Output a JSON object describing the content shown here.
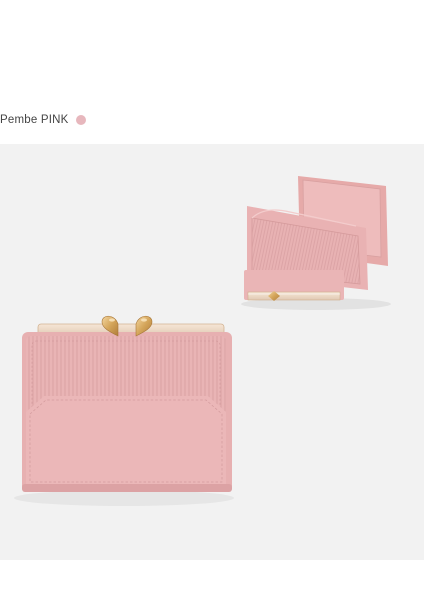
{
  "variant": {
    "label": "Pembe PINK",
    "swatch_color": "#e7b7bd"
  },
  "product_photo": {
    "subject": "pink-trifold-wallet",
    "background_color": "#f2f2f2",
    "wallet_color": "#e9b6b6",
    "clasp_color": "#d9a95e"
  }
}
